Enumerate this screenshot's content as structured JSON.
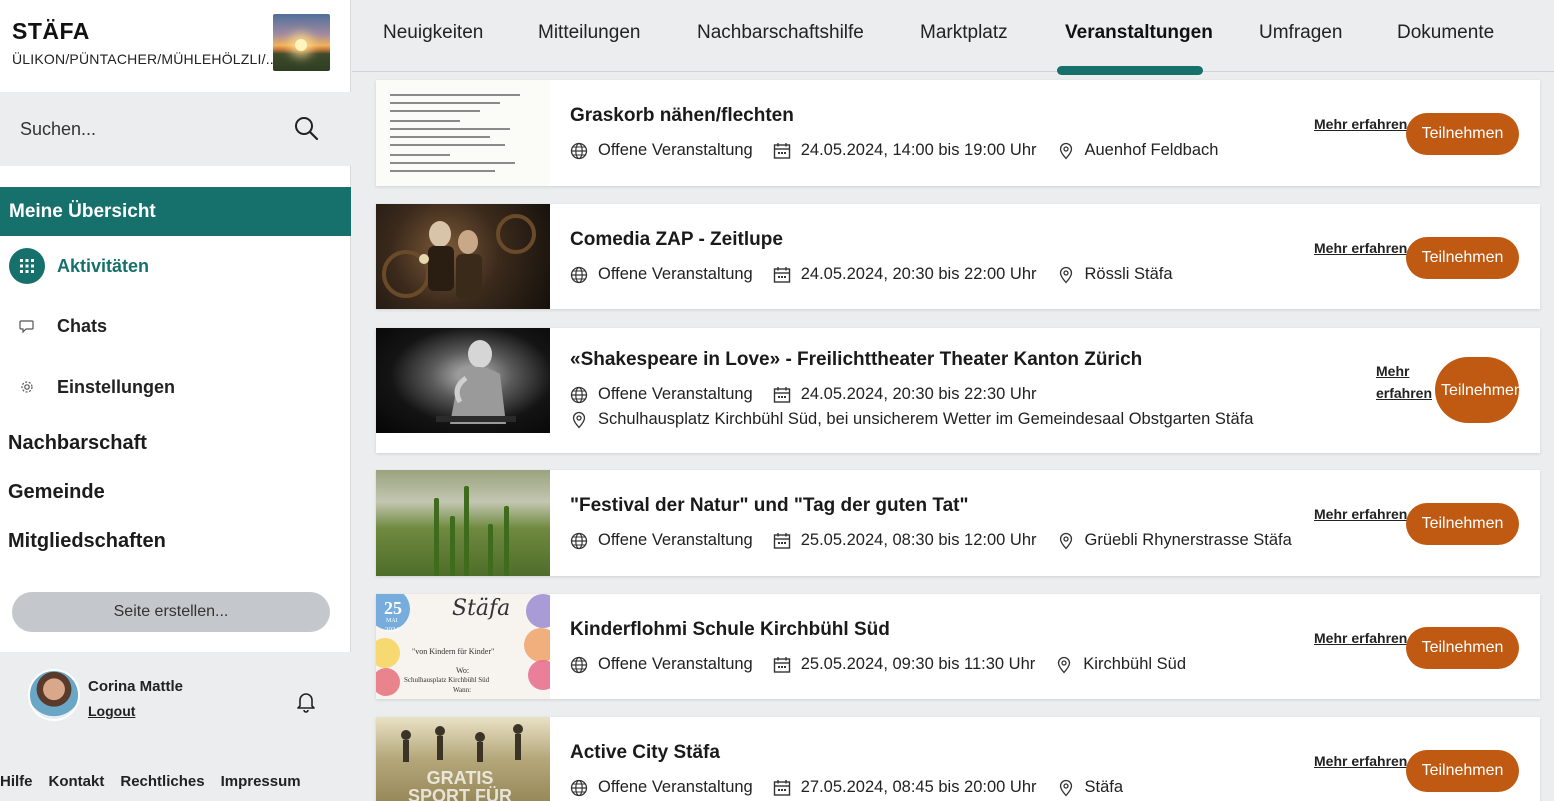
{
  "sidebar": {
    "brand_name": "STÄFA",
    "brand_sub": "ÜLIKON/PÜNTACHER/MÜHLEHÖLZLI/...",
    "search_placeholder": "Suchen...",
    "active_section": "Meine Übersicht",
    "sub_items": [
      {
        "label": "Aktivitäten",
        "icon": "grid-icon",
        "active": true
      },
      {
        "label": "Chats",
        "icon": "chat-icon",
        "active": false
      },
      {
        "label": "Einstellungen",
        "icon": "gear-icon",
        "active": false
      }
    ],
    "sections": [
      "Nachbarschaft",
      "Gemeinde",
      "Mitgliedschaften"
    ],
    "create_button": "Seite erstellen...",
    "user": {
      "name": "Corina Mattle",
      "logout": "Logout"
    },
    "footer_links": [
      "Hilfe",
      "Kontakt",
      "Rechtliches",
      "Impressum"
    ]
  },
  "tabs": [
    {
      "label": "Neuigkeiten",
      "active": false
    },
    {
      "label": "Mitteilungen",
      "active": false
    },
    {
      "label": "Nachbarschaftshilfe",
      "active": false
    },
    {
      "label": "Marktplatz",
      "active": false
    },
    {
      "label": "Veranstaltungen",
      "active": true
    },
    {
      "label": "Umfragen",
      "active": false
    },
    {
      "label": "Dokumente",
      "active": false
    }
  ],
  "events": [
    {
      "title": "Graskorb nähen/flechten",
      "type": "Offene Veranstaltung",
      "datetime": "24.05.2024, 14:00 bis 19:00 Uhr",
      "location": "Auenhof Feldbach",
      "more": "Mehr erfahren",
      "join": "Teilnehmen",
      "thumb": "document-flyer"
    },
    {
      "title": "Comedia ZAP - Zeitlupe",
      "type": "Offene Veranstaltung",
      "datetime": "24.05.2024, 20:30 bis 22:00 Uhr",
      "location": "Rössli Stäfa",
      "more": "Mehr erfahren",
      "join": "Teilnehmen",
      "thumb": "stage-performers"
    },
    {
      "title": "«Shakespeare in Love» - Freilichttheater Theater Kanton Zürich",
      "type": "Offene Veranstaltung",
      "datetime": "24.05.2024, 20:30 bis 22:30 Uhr",
      "location": "Schulhausplatz Kirchbühl Süd, bei unsicherem Wetter im Gemeindesaal Obstgarten Stäfa",
      "more": "Mehr erfahren",
      "join": "Teilnehmen",
      "thumb": "bw-actor"
    },
    {
      "title": "\"Festival der Natur\" und \"Tag der guten Tat\"",
      "type": "Offene Veranstaltung",
      "datetime": "25.05.2024, 08:30 bis 12:00 Uhr",
      "location": "Grüebli Rhynerstrasse Stäfa",
      "more": "Mehr erfahren",
      "join": "Teilnehmen",
      "thumb": "nature-plants"
    },
    {
      "title": "Kinderflohmi Schule Kirchbühl Süd",
      "type": "Offene Veranstaltung",
      "datetime": "25.05.2024, 09:30 bis 11:30 Uhr",
      "location": "Kirchbühl Süd",
      "more": "Mehr erfahren",
      "join": "Teilnehmen",
      "thumb": "kids-flyer",
      "thumb_text": {
        "day": "25",
        "month": "MAI",
        "year": "2024",
        "script": "Stäfa",
        "quote": "\"von Kindern für Kinder\"",
        "where_label": "Wo:",
        "where": "Schulhausplatz Kirchbühl Süd",
        "when_label": "Wann:"
      }
    },
    {
      "title": "Active City Stäfa",
      "type": "Offene Veranstaltung",
      "datetime": "27.05.2024, 08:45 bis 20:00 Uhr",
      "location": "Stäfa",
      "more": "Mehr erfahren",
      "join": "Teilnehmen",
      "thumb": "sport-group",
      "thumb_text": {
        "line1": "GRATIS",
        "line2": "SPORT FÜR"
      }
    }
  ],
  "colors": {
    "accent": "#16706c",
    "join_button": "#c05a12",
    "background": "#ebedef"
  }
}
